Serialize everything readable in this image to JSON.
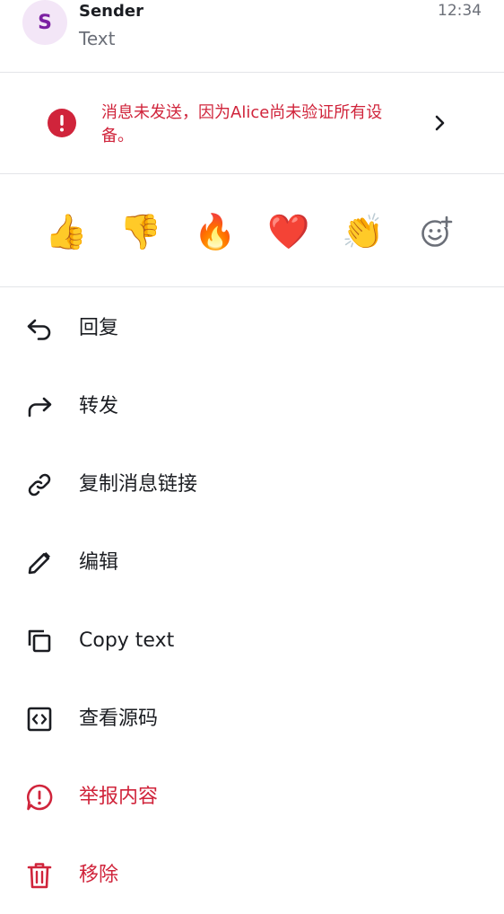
{
  "message": {
    "avatar_letter": "S",
    "sender": "Sender",
    "text": "Text",
    "time": "12:34"
  },
  "warning": {
    "text": "消息未发送，因为Alice尚未验证所有设备。",
    "icon": "error-icon",
    "color": "#d0243b"
  },
  "reactions": {
    "emojis": [
      "👍",
      "👎",
      "🔥",
      "❤️",
      "👏"
    ],
    "add_icon": "add-reaction-icon"
  },
  "menu": {
    "items": [
      {
        "label": "回复",
        "icon": "reply-icon"
      },
      {
        "label": "转发",
        "icon": "forward-icon"
      },
      {
        "label": "复制消息链接",
        "icon": "link-icon"
      },
      {
        "label": "编辑",
        "icon": "pencil-icon"
      },
      {
        "label": "Copy text",
        "icon": "copy-icon"
      },
      {
        "label": "查看源码",
        "icon": "code-icon"
      },
      {
        "label": "举报内容",
        "icon": "report-icon"
      },
      {
        "label": "移除",
        "icon": "trash-icon"
      }
    ]
  },
  "colors": {
    "danger": "#d0243b",
    "avatar_bg": "#f3e6f7",
    "avatar_fg": "#7b1fa2",
    "secondary_text": "#6b6f78"
  }
}
